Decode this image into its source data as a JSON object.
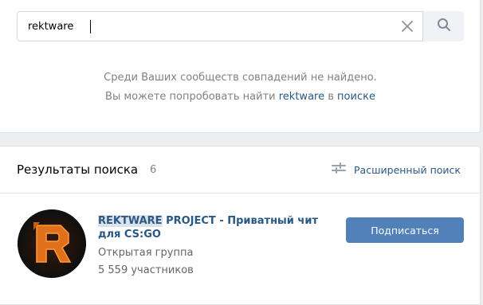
{
  "search": {
    "query": "rektware",
    "placeholder": ""
  },
  "empty": {
    "line1": "Среди Ваших сообществ совпадений не найдено.",
    "line2_prefix": "Вы можете попробовать найти",
    "line2_query": "rektware",
    "line2_mid": "в",
    "line2_link": "поиске"
  },
  "results": {
    "title": "Результаты поиска",
    "count": "6",
    "advanced_label": "Расширенный поиск"
  },
  "group": {
    "name_highlight": "REKTWARE",
    "name_rest": " PROJECT - Приватный чит для CS:GO",
    "type": "Открытая группа",
    "members": "5 559 участников",
    "subscribe_label": "Подписаться"
  },
  "colors": {
    "link": "#2a5885",
    "button": "#5181b8",
    "background": "#edeef0"
  }
}
